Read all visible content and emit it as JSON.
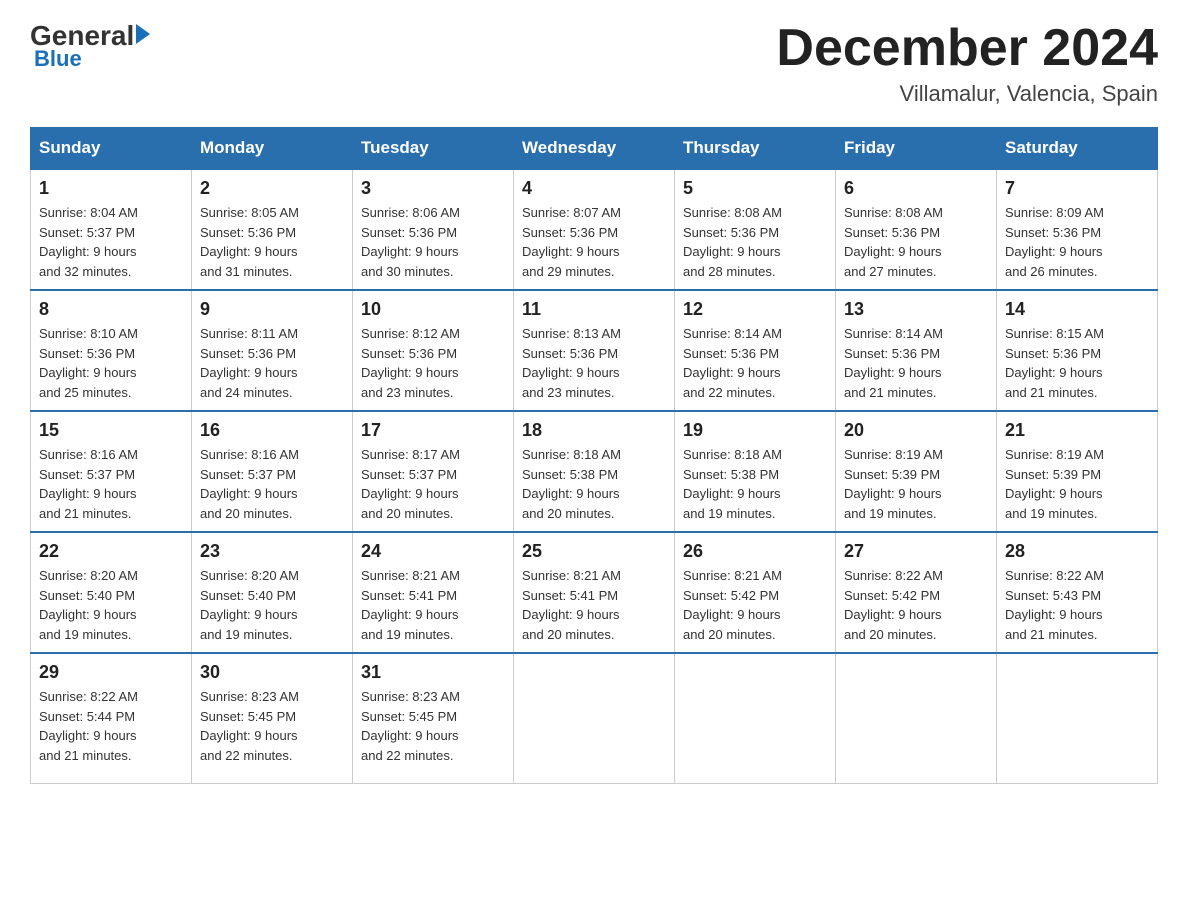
{
  "logo": {
    "general": "General",
    "blue": "Blue"
  },
  "title": "December 2024",
  "location": "Villamalur, Valencia, Spain",
  "days_of_week": [
    "Sunday",
    "Monday",
    "Tuesday",
    "Wednesday",
    "Thursday",
    "Friday",
    "Saturday"
  ],
  "weeks": [
    [
      {
        "day": "1",
        "info": "Sunrise: 8:04 AM\nSunset: 5:37 PM\nDaylight: 9 hours\nand 32 minutes."
      },
      {
        "day": "2",
        "info": "Sunrise: 8:05 AM\nSunset: 5:36 PM\nDaylight: 9 hours\nand 31 minutes."
      },
      {
        "day": "3",
        "info": "Sunrise: 8:06 AM\nSunset: 5:36 PM\nDaylight: 9 hours\nand 30 minutes."
      },
      {
        "day": "4",
        "info": "Sunrise: 8:07 AM\nSunset: 5:36 PM\nDaylight: 9 hours\nand 29 minutes."
      },
      {
        "day": "5",
        "info": "Sunrise: 8:08 AM\nSunset: 5:36 PM\nDaylight: 9 hours\nand 28 minutes."
      },
      {
        "day": "6",
        "info": "Sunrise: 8:08 AM\nSunset: 5:36 PM\nDaylight: 9 hours\nand 27 minutes."
      },
      {
        "day": "7",
        "info": "Sunrise: 8:09 AM\nSunset: 5:36 PM\nDaylight: 9 hours\nand 26 minutes."
      }
    ],
    [
      {
        "day": "8",
        "info": "Sunrise: 8:10 AM\nSunset: 5:36 PM\nDaylight: 9 hours\nand 25 minutes."
      },
      {
        "day": "9",
        "info": "Sunrise: 8:11 AM\nSunset: 5:36 PM\nDaylight: 9 hours\nand 24 minutes."
      },
      {
        "day": "10",
        "info": "Sunrise: 8:12 AM\nSunset: 5:36 PM\nDaylight: 9 hours\nand 23 minutes."
      },
      {
        "day": "11",
        "info": "Sunrise: 8:13 AM\nSunset: 5:36 PM\nDaylight: 9 hours\nand 23 minutes."
      },
      {
        "day": "12",
        "info": "Sunrise: 8:14 AM\nSunset: 5:36 PM\nDaylight: 9 hours\nand 22 minutes."
      },
      {
        "day": "13",
        "info": "Sunrise: 8:14 AM\nSunset: 5:36 PM\nDaylight: 9 hours\nand 21 minutes."
      },
      {
        "day": "14",
        "info": "Sunrise: 8:15 AM\nSunset: 5:36 PM\nDaylight: 9 hours\nand 21 minutes."
      }
    ],
    [
      {
        "day": "15",
        "info": "Sunrise: 8:16 AM\nSunset: 5:37 PM\nDaylight: 9 hours\nand 21 minutes."
      },
      {
        "day": "16",
        "info": "Sunrise: 8:16 AM\nSunset: 5:37 PM\nDaylight: 9 hours\nand 20 minutes."
      },
      {
        "day": "17",
        "info": "Sunrise: 8:17 AM\nSunset: 5:37 PM\nDaylight: 9 hours\nand 20 minutes."
      },
      {
        "day": "18",
        "info": "Sunrise: 8:18 AM\nSunset: 5:38 PM\nDaylight: 9 hours\nand 20 minutes."
      },
      {
        "day": "19",
        "info": "Sunrise: 8:18 AM\nSunset: 5:38 PM\nDaylight: 9 hours\nand 19 minutes."
      },
      {
        "day": "20",
        "info": "Sunrise: 8:19 AM\nSunset: 5:39 PM\nDaylight: 9 hours\nand 19 minutes."
      },
      {
        "day": "21",
        "info": "Sunrise: 8:19 AM\nSunset: 5:39 PM\nDaylight: 9 hours\nand 19 minutes."
      }
    ],
    [
      {
        "day": "22",
        "info": "Sunrise: 8:20 AM\nSunset: 5:40 PM\nDaylight: 9 hours\nand 19 minutes."
      },
      {
        "day": "23",
        "info": "Sunrise: 8:20 AM\nSunset: 5:40 PM\nDaylight: 9 hours\nand 19 minutes."
      },
      {
        "day": "24",
        "info": "Sunrise: 8:21 AM\nSunset: 5:41 PM\nDaylight: 9 hours\nand 19 minutes."
      },
      {
        "day": "25",
        "info": "Sunrise: 8:21 AM\nSunset: 5:41 PM\nDaylight: 9 hours\nand 20 minutes."
      },
      {
        "day": "26",
        "info": "Sunrise: 8:21 AM\nSunset: 5:42 PM\nDaylight: 9 hours\nand 20 minutes."
      },
      {
        "day": "27",
        "info": "Sunrise: 8:22 AM\nSunset: 5:42 PM\nDaylight: 9 hours\nand 20 minutes."
      },
      {
        "day": "28",
        "info": "Sunrise: 8:22 AM\nSunset: 5:43 PM\nDaylight: 9 hours\nand 21 minutes."
      }
    ],
    [
      {
        "day": "29",
        "info": "Sunrise: 8:22 AM\nSunset: 5:44 PM\nDaylight: 9 hours\nand 21 minutes."
      },
      {
        "day": "30",
        "info": "Sunrise: 8:23 AM\nSunset: 5:45 PM\nDaylight: 9 hours\nand 22 minutes."
      },
      {
        "day": "31",
        "info": "Sunrise: 8:23 AM\nSunset: 5:45 PM\nDaylight: 9 hours\nand 22 minutes."
      },
      {
        "day": "",
        "info": ""
      },
      {
        "day": "",
        "info": ""
      },
      {
        "day": "",
        "info": ""
      },
      {
        "day": "",
        "info": ""
      }
    ]
  ]
}
